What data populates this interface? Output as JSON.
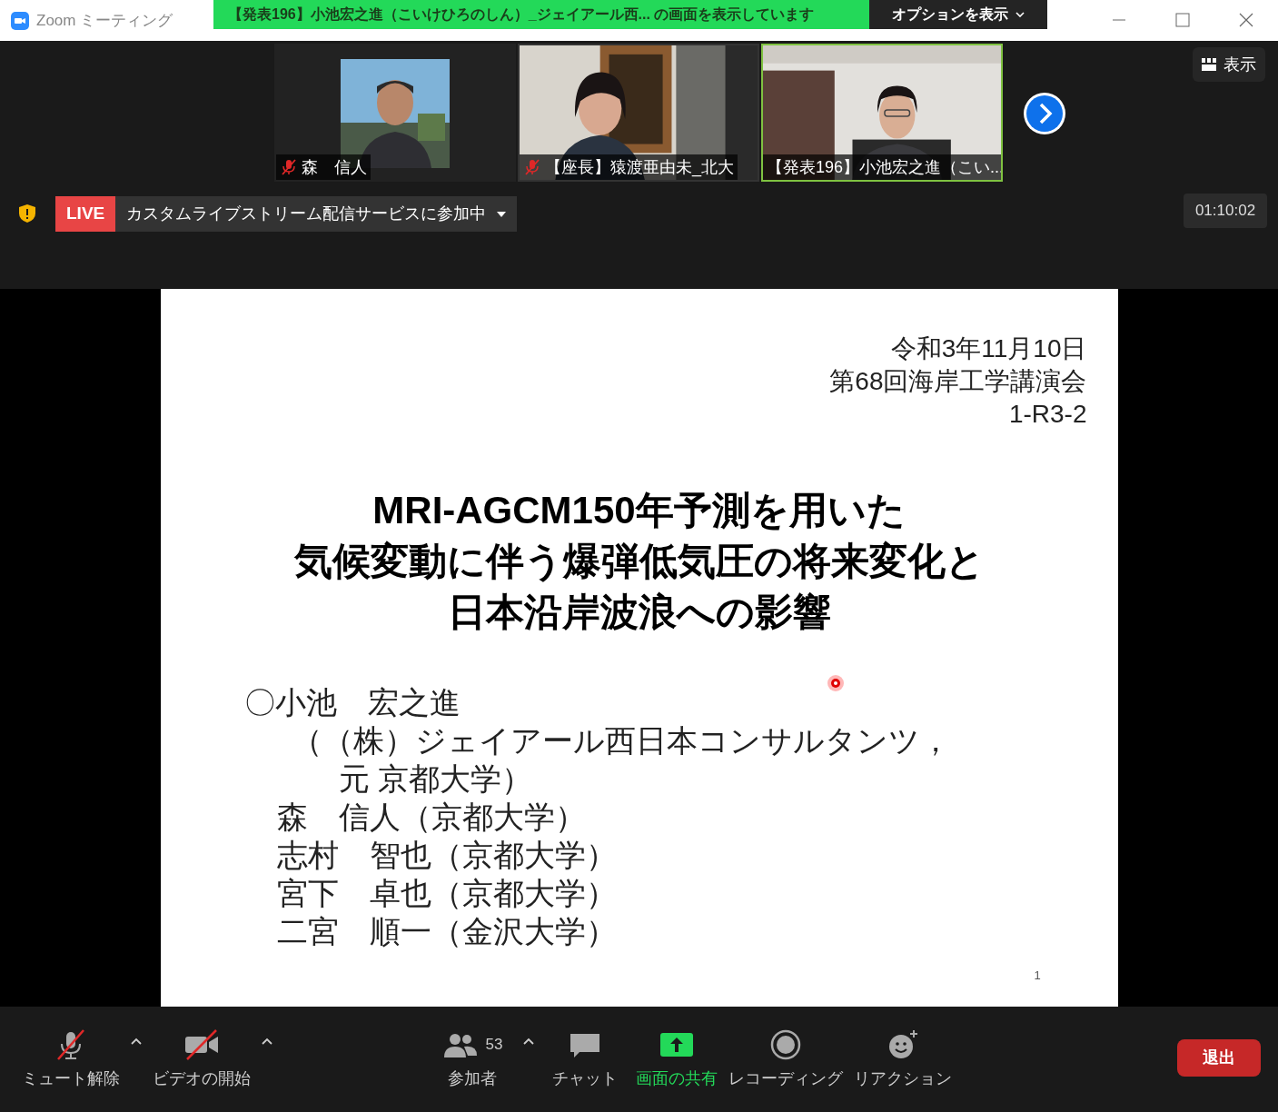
{
  "title_bar": {
    "app_title": "Zoom ミーティング",
    "share_banner": "【発表196】小池宏之進（こいけひろのしん）_ジェイアール西... の画面を表示しています",
    "options_button": "オプションを表示"
  },
  "participants": [
    {
      "name": "森　信人",
      "muted": true,
      "speaking": false
    },
    {
      "name": "【座長】猿渡亜由未_北大",
      "muted": true,
      "speaking": false,
      "kind": "video"
    },
    {
      "name": "【発表196】小池宏之進（こい...",
      "muted": false,
      "speaking": true,
      "kind": "video"
    }
  ],
  "view_button": "表示",
  "live": {
    "badge": "LIVE",
    "text": "カスタムライブストリーム配信サービスに参加中"
  },
  "timer": "01:10:02",
  "slide": {
    "header_lines": [
      "令和3年11月10日",
      "第68回海岸工学講演会",
      "1-R3-2"
    ],
    "title_lines": [
      "MRI-AGCM150年予測を用いた",
      "気候変動に伴う爆弾低気圧の将来変化と",
      "日本沿岸波浪への影響"
    ],
    "author_lines": [
      {
        "kind": "presenter",
        "text": "〇小池　宏之進"
      },
      {
        "kind": "affiliation",
        "text": "（（株）ジェイアール西日本コンサルタンツ，"
      },
      {
        "kind": "affiliation_cont",
        "text": "元 京都大学）"
      },
      {
        "kind": "author",
        "text": "森　信人（京都大学）"
      },
      {
        "kind": "author",
        "text": "志村　智也（京都大学）"
      },
      {
        "kind": "author",
        "text": "宮下　卓也（京都大学）"
      },
      {
        "kind": "author",
        "text": "二宮　順一（金沢大学）"
      }
    ],
    "page_number": "1"
  },
  "toolbar": [
    {
      "kind": "mic",
      "label": "ミュート解除",
      "menu": true
    },
    {
      "kind": "video",
      "label": "ビデオの開始",
      "menu": true
    },
    {
      "kind": "participants",
      "label": "参加者",
      "count": "53",
      "menu": true
    },
    {
      "kind": "chat",
      "label": "チャット",
      "menu": false
    },
    {
      "kind": "share",
      "label": "画面の共有",
      "menu": false
    },
    {
      "kind": "record",
      "label": "レコーディング",
      "menu": false
    },
    {
      "kind": "reaction",
      "label": "リアクション",
      "menu": false
    }
  ],
  "leave_button": "退出"
}
